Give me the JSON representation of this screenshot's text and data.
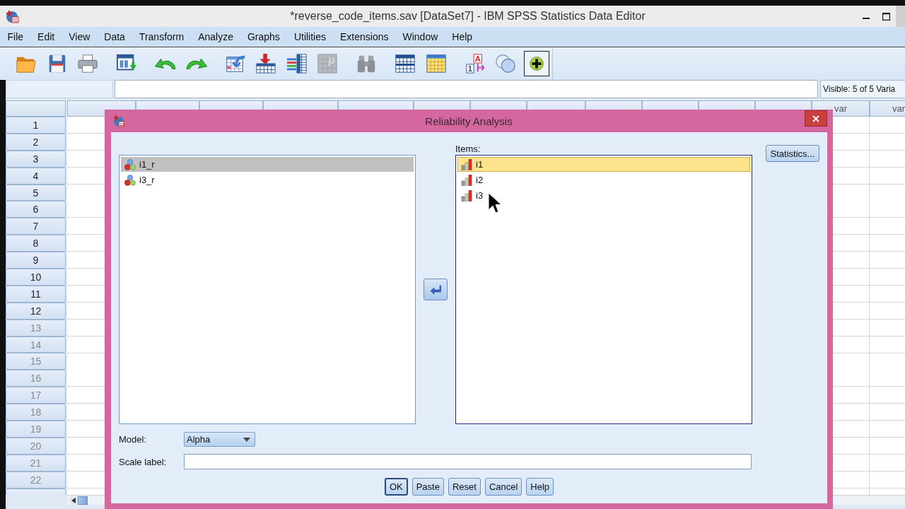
{
  "window": {
    "title": "*reverse_code_items.sav [DataSet7] - IBM SPSS Statistics Data Editor"
  },
  "menu": [
    "File",
    "Edit",
    "View",
    "Data",
    "Transform",
    "Analyze",
    "Graphs",
    "Utilities",
    "Extensions",
    "Window",
    "Help"
  ],
  "toolbar": [
    [
      {
        "kind": "open",
        "disabled": false,
        "on": false
      },
      {
        "kind": "save",
        "disabled": false,
        "on": false
      },
      {
        "kind": "print",
        "disabled": false,
        "on": false
      }
    ],
    [
      {
        "kind": "dataview",
        "disabled": false,
        "on": false
      }
    ],
    [
      {
        "kind": "undo",
        "disabled": false,
        "on": false
      },
      {
        "kind": "redo",
        "disabled": false,
        "on": false
      }
    ],
    [
      {
        "kind": "gotocase",
        "disabled": false,
        "on": false
      },
      {
        "kind": "insertcase",
        "disabled": false,
        "on": false
      },
      {
        "kind": "insertvariable",
        "disabled": false,
        "on": false
      },
      {
        "kind": "split",
        "marks": [
          "μ"
        ],
        "disabled": true,
        "on": false
      }
    ],
    [
      {
        "kind": "find",
        "disabled": true,
        "on": false
      }
    ],
    [
      {
        "kind": "table",
        "disabled": false,
        "on": false
      },
      {
        "kind": "yellowtable",
        "disabled": false,
        "on": false
      }
    ],
    [
      {
        "kind": "labels",
        "marks": [
          "A",
          "1"
        ],
        "disabled": false,
        "on": false
      },
      {
        "kind": "sets",
        "disabled": false,
        "on": false
      },
      {
        "kind": "extension",
        "disabled": false,
        "on": true
      }
    ]
  ],
  "edit_bar": {
    "visible_count": "Visible: 5 of 5 Varia"
  },
  "grid": {
    "columns": [
      {
        "label": "var"
      },
      {
        "label": "var"
      }
    ],
    "rows": [
      {
        "number": "1",
        "empty": false
      },
      {
        "number": "2",
        "empty": false
      },
      {
        "number": "3",
        "empty": false
      },
      {
        "number": "4",
        "empty": false
      },
      {
        "number": "5",
        "empty": false
      },
      {
        "number": "6",
        "empty": false
      },
      {
        "number": "7",
        "empty": false
      },
      {
        "number": "8",
        "empty": false
      },
      {
        "number": "9",
        "empty": false
      },
      {
        "number": "10",
        "empty": false
      },
      {
        "number": "11",
        "empty": false
      },
      {
        "number": "12",
        "empty": false
      },
      {
        "number": "13",
        "empty": true
      },
      {
        "number": "14",
        "empty": true
      },
      {
        "number": "15",
        "empty": true
      },
      {
        "number": "16",
        "empty": true
      },
      {
        "number": "17",
        "empty": true
      },
      {
        "number": "18",
        "empty": true
      },
      {
        "number": "19",
        "empty": true
      },
      {
        "number": "20",
        "empty": true
      },
      {
        "number": "21",
        "empty": true
      },
      {
        "number": "22",
        "empty": true
      }
    ]
  },
  "dialog": {
    "title": "Reliability Analysis",
    "source_list": [
      {
        "label": "i1_r",
        "kind": "nominal",
        "selected": true
      },
      {
        "label": "i3_r",
        "kind": "nominal",
        "selected": false
      }
    ],
    "items_label": "Items:",
    "items": [
      {
        "label": "i1",
        "kind": "scale",
        "selected": true
      },
      {
        "label": "i2",
        "kind": "scale",
        "selected": false
      },
      {
        "label": "i3",
        "kind": "scale",
        "selected": false
      }
    ],
    "statistics_button": "Statistics...",
    "model": {
      "label": "Model:",
      "value": "Alpha"
    },
    "scale_label": {
      "label": "Scale label:"
    },
    "buttons": [
      {
        "label": "OK",
        "default": true
      },
      {
        "label": "Paste",
        "default": false
      },
      {
        "label": "Reset",
        "default": false
      },
      {
        "label": "Cancel",
        "default": false
      },
      {
        "label": "Help",
        "default": false
      }
    ]
  }
}
